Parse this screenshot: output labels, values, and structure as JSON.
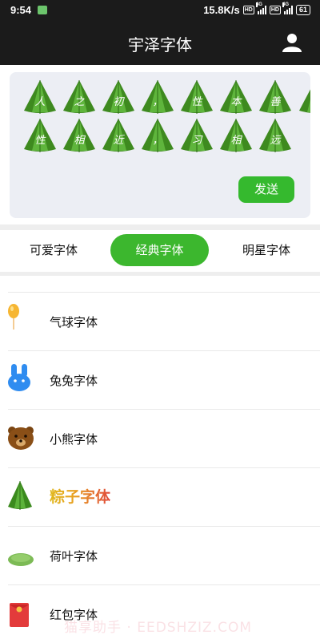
{
  "status": {
    "time": "9:54",
    "speed": "15.8K/s",
    "hd1": "HD",
    "net1": "4G",
    "hd2": "HD",
    "net2": "4G",
    "battery": "61"
  },
  "header": {
    "title": "宇泽字体"
  },
  "preview": {
    "row1": [
      "人",
      "之",
      "初",
      "，",
      "性",
      "本",
      "善"
    ],
    "row2": [
      "性",
      "相",
      "近",
      "，",
      "习",
      "相",
      "远"
    ],
    "send_label": "发送"
  },
  "tabs": [
    {
      "label": "可爱字体",
      "active": false
    },
    {
      "label": "经典字体",
      "active": true
    },
    {
      "label": "明星字体",
      "active": false
    }
  ],
  "fonts": [
    {
      "label": "气球字体",
      "icon": "balloon-icon"
    },
    {
      "label": "兔兔字体",
      "icon": "rabbit-icon"
    },
    {
      "label": "小熊字体",
      "icon": "bear-icon"
    },
    {
      "label": "粽子字体",
      "icon": "zongzi-icon"
    },
    {
      "label": "荷叶字体",
      "icon": "lotus-leaf-icon"
    },
    {
      "label": "红包字体",
      "icon": "red-envelope-icon"
    }
  ],
  "watermark": "猫享助手 · EEDSHZIZ.COM",
  "colors": {
    "accent": "#3cb72e",
    "header_bg": "#1b1b1b",
    "preview_bg": "#eceef4"
  }
}
